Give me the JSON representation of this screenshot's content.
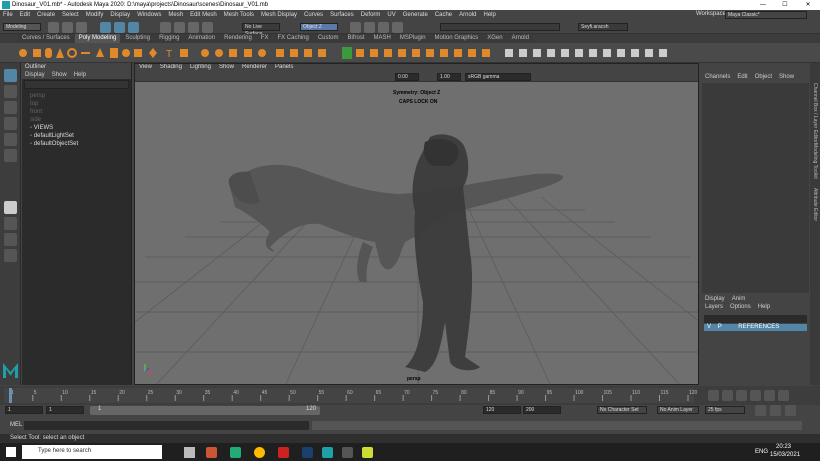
{
  "window": {
    "title": "Dinosaur_V01.mb* - Autodesk Maya 2020: D:\\maya\\projects\\Dinosaur\\scenes\\Dinosaur_V01.mb",
    "minimize": "—",
    "maximize": "☐",
    "close": "✕"
  },
  "menubar": [
    "File",
    "Edit",
    "Create",
    "Select",
    "Modify",
    "Display",
    "Windows",
    "Mesh",
    "Edit Mesh",
    "Mesh Tools",
    "Mesh Display",
    "Curves",
    "Surfaces",
    "Deform",
    "UV",
    "Generate",
    "Cache",
    "Arnold",
    "Help"
  ],
  "workspace": {
    "label": "Workspace :",
    "value": "Maya Classic*"
  },
  "statusline": {
    "mode": "Modeling",
    "live_surface": "No Live Surface",
    "object_field": "Object Z",
    "user": "Seyfi.aracsh"
  },
  "shelf_tabs": [
    "Curves / Surfaces",
    "Poly Modeling",
    "Sculpting",
    "Rigging",
    "Animation",
    "Rendering",
    "FX",
    "FX Caching",
    "Custom",
    "Bifrost",
    "MASH",
    "MSPlugin",
    "Motion Graphics",
    "XGen",
    "Arnold"
  ],
  "shelf_active": "Poly Modeling",
  "outliner": {
    "title": "Outliner",
    "menu": [
      "Display",
      "Show",
      "Help"
    ],
    "items": [
      {
        "label": "persp",
        "dim": true
      },
      {
        "label": "top",
        "dim": true
      },
      {
        "label": "front",
        "dim": true
      },
      {
        "label": "side",
        "dim": true
      },
      {
        "label": "VIEWS",
        "dim": false
      },
      {
        "label": "defaultLightSet",
        "dim": false
      },
      {
        "label": "defaultObjectSet",
        "dim": false
      }
    ]
  },
  "viewport": {
    "menu": [
      "View",
      "Shading",
      "Lighting",
      "Show",
      "Renderer",
      "Panels"
    ],
    "exposure": "0.00",
    "gamma": "1.00",
    "color_space": "sRGB gamma",
    "hud_symmetry": "Symmetry: Object Z",
    "hud_caps": "CAPS LOCK ON",
    "camera": "persp"
  },
  "channel_box": {
    "menu": [
      "Channels",
      "Edit",
      "Object",
      "Show"
    ]
  },
  "layer_editor": {
    "tabs": [
      "Display",
      "Anim"
    ],
    "menu": [
      "Layers",
      "Options",
      "Help"
    ],
    "layer_v": "V",
    "layer_p": "P",
    "layer_name": "REFERENCES"
  },
  "right_strip": [
    "Channel Box / Layer Editor",
    "Modeling Toolkit",
    "Attribute Editor"
  ],
  "timeline": {
    "ticks": [
      "1",
      "5",
      "10",
      "15",
      "20",
      "25",
      "30",
      "35",
      "40",
      "45",
      "50",
      "55",
      "60",
      "65",
      "70",
      "75",
      "80",
      "85",
      "90",
      "95",
      "100",
      "105",
      "110",
      "115",
      "120"
    ],
    "current": "1"
  },
  "range": {
    "start": "1",
    "playback_start": "1",
    "slider_start": "1",
    "slider_end": "120",
    "playback_end": "120",
    "end": "200",
    "character_set": "No Character Set",
    "anim_layer": "No Anim Layer",
    "fps": "25 fps"
  },
  "cmdline": {
    "label": "MEL"
  },
  "helpline": "Select Tool: select an object",
  "taskbar": {
    "search": "Type here to search",
    "time": "20:23",
    "date": "15/03/2021",
    "lang": "ENG"
  },
  "colors": {
    "accent_blue": "#5285a6",
    "maya_teal": "#1fa0a8",
    "shelf_orange": "#e0892b",
    "viewport_bg": "#6f6f6f"
  }
}
